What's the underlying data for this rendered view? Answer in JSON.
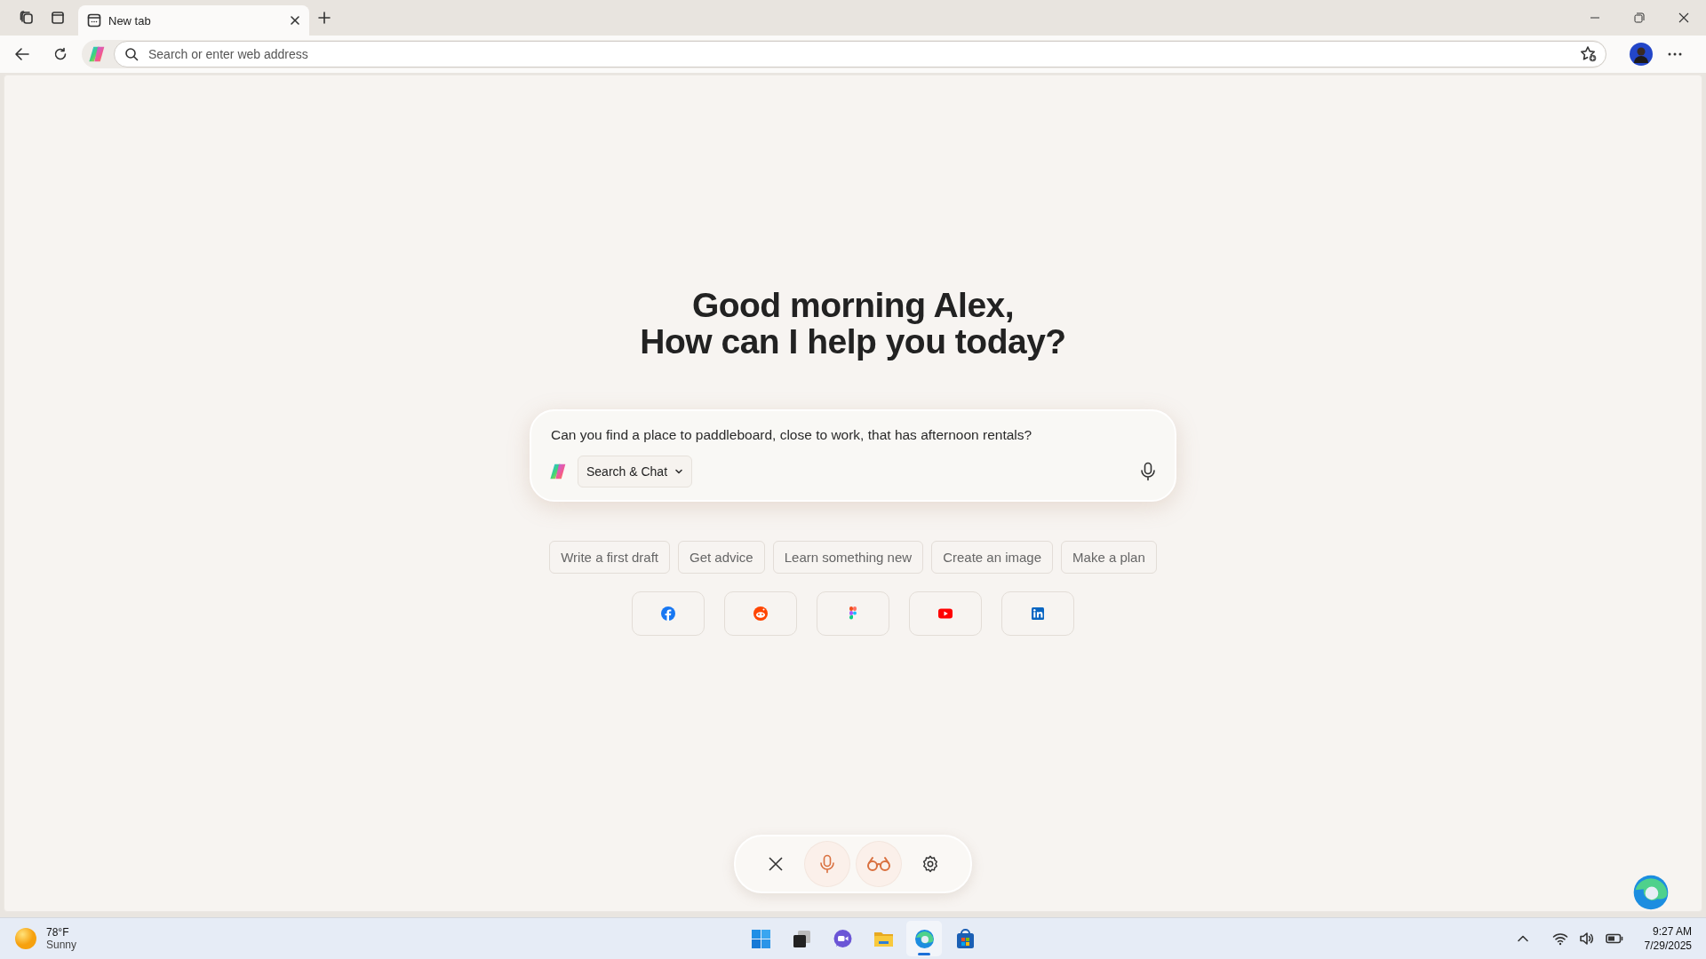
{
  "browser": {
    "tabs": [
      {
        "title": "New tab",
        "selected": true
      }
    ],
    "address_bar": {
      "placeholder": "Search or enter web address"
    }
  },
  "greeting": {
    "line_1": "Good morning Alex,",
    "line_2": "How can I help you today?"
  },
  "prompt": {
    "value": "Can you find a place to paddleboard, close to work, that has afternoon rentals?",
    "mode": "Search & Chat"
  },
  "suggestions": [
    "Write a first draft",
    "Get advice",
    "Learn something new",
    "Create an image",
    "Make a plan"
  ],
  "shortcuts": [
    {
      "kind": "facebook"
    },
    {
      "kind": "reddit"
    },
    {
      "kind": "figma"
    },
    {
      "kind": "youtube"
    },
    {
      "kind": "linkedin"
    }
  ],
  "voice_toolbar": [
    {
      "kind": "close",
      "active": false
    },
    {
      "kind": "microphone",
      "active": true
    },
    {
      "kind": "glasses",
      "active": true
    },
    {
      "kind": "settings",
      "active": false
    }
  ],
  "taskbar": {
    "weather": {
      "temperature": "78°F",
      "condition": "Sunny"
    },
    "apps": [
      {
        "kind": "start",
        "selected": false
      },
      {
        "kind": "task-view",
        "selected": false
      },
      {
        "kind": "chat",
        "selected": false
      },
      {
        "kind": "folder",
        "selected": false
      },
      {
        "kind": "edge",
        "selected": true
      },
      {
        "kind": "store",
        "selected": false
      }
    ],
    "time": "9:27 AM",
    "date": "7/29/2025"
  }
}
